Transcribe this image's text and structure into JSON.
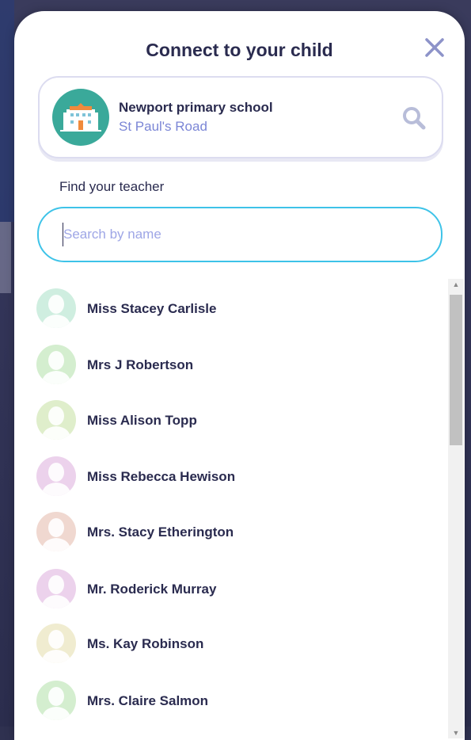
{
  "modal": {
    "title": "Connect to your child"
  },
  "school": {
    "name": "Newport primary school",
    "address": "St Paul's Road"
  },
  "teacher_search": {
    "label": "Find your teacher",
    "placeholder": "Search by name",
    "value": ""
  },
  "teachers": [
    {
      "name": "Miss Stacey Carlisle",
      "avatar_color": "#cfeee0"
    },
    {
      "name": "Mrs J Robertson",
      "avatar_color": "#d4eecf"
    },
    {
      "name": "Miss Alison Topp",
      "avatar_color": "#dfeecb"
    },
    {
      "name": "Miss Rebecca Hewison",
      "avatar_color": "#ecd2ec"
    },
    {
      "name": "Mrs. Stacy Etherington",
      "avatar_color": "#f0d8d0"
    },
    {
      "name": "Mr. Roderick Murray",
      "avatar_color": "#ecd2ec"
    },
    {
      "name": "Ms. Kay Robinson",
      "avatar_color": "#f0ecd0"
    },
    {
      "name": "Mrs. Claire Salmon",
      "avatar_color": "#d4eecf"
    }
  ],
  "icons": {
    "close": "close-icon",
    "school": "school-building-icon",
    "search": "search-icon",
    "avatar": "person-silhouette-icon"
  },
  "colors": {
    "text_dark": "#2a2b4f",
    "accent_blue": "#3ec3e8",
    "address_purple": "#7b86d6",
    "school_teal": "#3aa99a"
  }
}
